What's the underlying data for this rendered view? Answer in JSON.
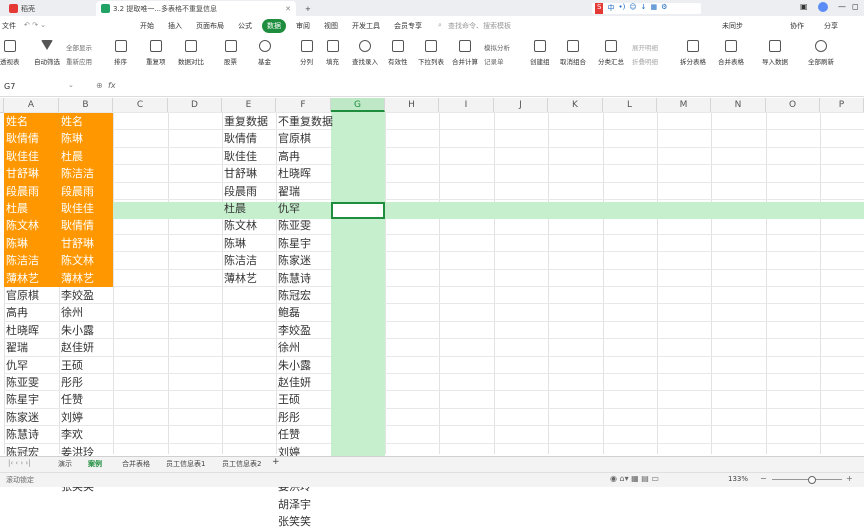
{
  "window": {
    "tabs": [
      {
        "label": "稻壳"
      },
      {
        "label": "3.2  提取唯一...多表格不重复信息"
      },
      {
        "label": "+"
      }
    ],
    "right_tools": [
      "中",
      "•)",
      "☺",
      "↓",
      "▦",
      "⚙",
      "⋯"
    ]
  },
  "menubar": {
    "file": "文件",
    "items": [
      "开始",
      "插入",
      "页面布局",
      "公式",
      "数据",
      "审阅",
      "视图",
      "开发工具",
      "会员专享"
    ],
    "active": "数据",
    "search_placeholder": "查找命令、搜索模板",
    "right": [
      "未同步",
      "协作",
      "分享"
    ]
  },
  "toolbar": {
    "tools": [
      "透视表",
      "自动筛选",
      "排序",
      "重复项",
      "数据对比",
      "股票",
      "基金",
      "分列",
      "填充",
      "查找录入",
      "有效性",
      "下拉列表",
      "合并计算",
      "创建组",
      "取消组合",
      "分类汇总",
      "拆分表格",
      "合并表格",
      "导入数据",
      "全部刷新"
    ],
    "small": [
      "全部显示",
      "重新应用",
      "模拟分析",
      "记录单",
      "展开明细",
      "折叠明细"
    ]
  },
  "formula_bar": {
    "cell_ref": "G7",
    "fx": "fx",
    "value": ""
  },
  "columns": [
    "A",
    "B",
    "C",
    "D",
    "E",
    "F",
    "G",
    "H",
    "I",
    "J",
    "K",
    "L",
    "M",
    "N",
    "O",
    "P"
  ],
  "selected_column": "G",
  "sheet": {
    "colA": [
      "姓名",
      "耿倩倩",
      "耿佳佳",
      "甘舒琳",
      "段晨雨",
      "杜晨",
      "陈文林",
      "陈琳",
      "陈洁洁",
      "薄林艺",
      "官原棋",
      "高冉",
      "杜晓晖",
      "翟瑞",
      "仇罕",
      "陈亚雯",
      "陈星宇",
      "陈家迷",
      "陈慧诗",
      "陈冠宏",
      "鲍磊"
    ],
    "colB": [
      "姓名",
      "陈琳",
      "杜晨",
      "陈洁洁",
      "段晨雨",
      "耿佳佳",
      "耿倩倩",
      "甘舒琳",
      "陈文林",
      "薄林艺",
      "李姣盈",
      "徐州",
      "朱小露",
      "赵佳妍",
      "王硕",
      "彤彤",
      "任赞",
      "刘婷",
      "李欢",
      "姜洪玲",
      "胡泽宇",
      "张笑笑"
    ],
    "colE": [
      "重复数据",
      "耿倩倩",
      "耿佳佳",
      "甘舒琳",
      "段晨雨",
      "杜晨",
      "陈文林",
      "陈琳",
      "陈洁洁",
      "薄林艺"
    ],
    "colF": [
      "不重复数据",
      "官原棋",
      "高冉",
      "杜晓晖",
      "翟瑞",
      "仇罕",
      "陈亚雯",
      "陈星宇",
      "陈家迷",
      "陈慧诗",
      "陈冠宏",
      "鲍磊",
      "李姣盈",
      "徐州",
      "朱小露",
      "赵佳妍",
      "王硕",
      "彤彤",
      "任赞",
      "刘婷",
      "李欢",
      "姜洪玲",
      "胡泽宇",
      "张笑笑"
    ]
  },
  "sheet_tabs": {
    "tabs": [
      "演示",
      "案例",
      "合并表格",
      "员工信息表1",
      "员工信息表2",
      "+"
    ],
    "active": "案例"
  },
  "status": {
    "left": "滚动锁定",
    "zoom": "133%"
  },
  "colors": {
    "accent": "#1e8e3e",
    "orange": "#ff9800",
    "highlight": "#c6efce"
  }
}
